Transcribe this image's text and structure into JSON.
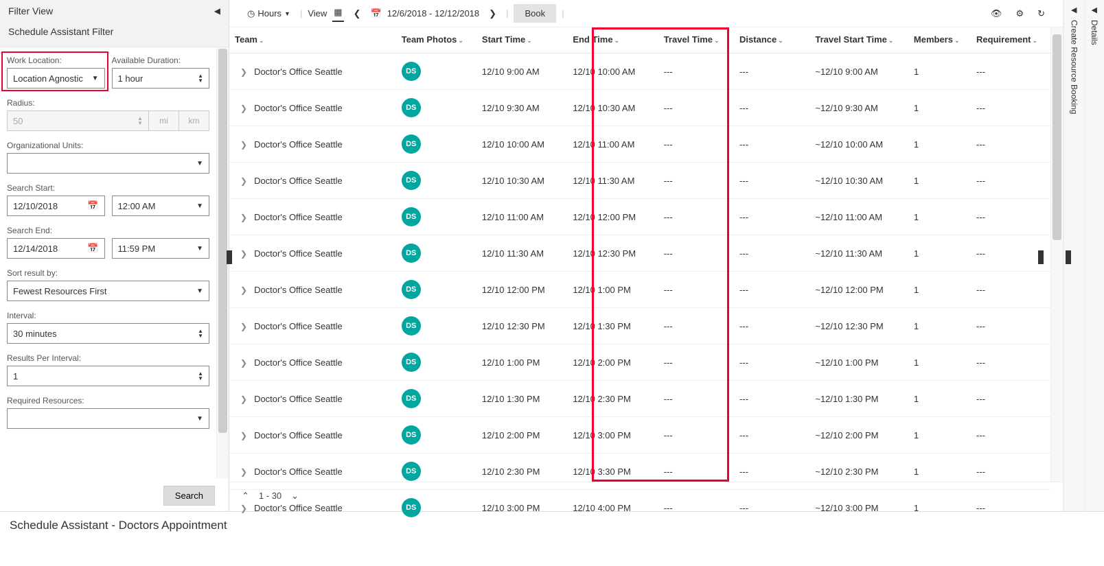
{
  "filter_panel": {
    "header": "Filter View",
    "section_title": "Schedule Assistant Filter",
    "work_location": {
      "label": "Work Location:",
      "value": "Location Agnostic"
    },
    "available_duration": {
      "label": "Available Duration:",
      "value": "1 hour"
    },
    "radius": {
      "label": "Radius:",
      "value": "50",
      "unit_mi": "mi",
      "unit_km": "km"
    },
    "org_units": {
      "label": "Organizational Units:",
      "value": ""
    },
    "search_start": {
      "label": "Search Start:",
      "date": "12/10/2018",
      "time": "12:00 AM"
    },
    "search_end": {
      "label": "Search End:",
      "date": "12/14/2018",
      "time": "11:59 PM"
    },
    "sort_by": {
      "label": "Sort result by:",
      "value": "Fewest Resources First"
    },
    "interval": {
      "label": "Interval:",
      "value": "30 minutes"
    },
    "results_per_interval": {
      "label": "Results Per Interval:",
      "value": "1"
    },
    "required_resources": {
      "label": "Required Resources:",
      "value": ""
    },
    "search_btn": "Search"
  },
  "toolbar": {
    "hours": "Hours",
    "view": "View",
    "date_range": "12/6/2018 - 12/12/2018",
    "book": "Book"
  },
  "columns": [
    "Team",
    "Team Photos",
    "Start Time",
    "End Time",
    "Travel Time",
    "Distance",
    "Travel Start Time",
    "Members",
    "Requirement"
  ],
  "rows": [
    {
      "team": "Doctor's Office Seattle",
      "photo": "DS",
      "start": "12/10 9:00 AM",
      "end": "12/10 10:00 AM",
      "travel_time": "---",
      "distance": "---",
      "travel_start": "~12/10 9:00 AM",
      "members": "1",
      "req": "---"
    },
    {
      "team": "Doctor's Office Seattle",
      "photo": "DS",
      "start": "12/10 9:30 AM",
      "end": "12/10 10:30 AM",
      "travel_time": "---",
      "distance": "---",
      "travel_start": "~12/10 9:30 AM",
      "members": "1",
      "req": "---"
    },
    {
      "team": "Doctor's Office Seattle",
      "photo": "DS",
      "start": "12/10 10:00 AM",
      "end": "12/10 11:00 AM",
      "travel_time": "---",
      "distance": "---",
      "travel_start": "~12/10 10:00 AM",
      "members": "1",
      "req": "---"
    },
    {
      "team": "Doctor's Office Seattle",
      "photo": "DS",
      "start": "12/10 10:30 AM",
      "end": "12/10 11:30 AM",
      "travel_time": "---",
      "distance": "---",
      "travel_start": "~12/10 10:30 AM",
      "members": "1",
      "req": "---"
    },
    {
      "team": "Doctor's Office Seattle",
      "photo": "DS",
      "start": "12/10 11:00 AM",
      "end": "12/10 12:00 PM",
      "travel_time": "---",
      "distance": "---",
      "travel_start": "~12/10 11:00 AM",
      "members": "1",
      "req": "---"
    },
    {
      "team": "Doctor's Office Seattle",
      "photo": "DS",
      "start": "12/10 11:30 AM",
      "end": "12/10 12:30 PM",
      "travel_time": "---",
      "distance": "---",
      "travel_start": "~12/10 11:30 AM",
      "members": "1",
      "req": "---"
    },
    {
      "team": "Doctor's Office Seattle",
      "photo": "DS",
      "start": "12/10 12:00 PM",
      "end": "12/10 1:00 PM",
      "travel_time": "---",
      "distance": "---",
      "travel_start": "~12/10 12:00 PM",
      "members": "1",
      "req": "---"
    },
    {
      "team": "Doctor's Office Seattle",
      "photo": "DS",
      "start": "12/10 12:30 PM",
      "end": "12/10 1:30 PM",
      "travel_time": "---",
      "distance": "---",
      "travel_start": "~12/10 12:30 PM",
      "members": "1",
      "req": "---"
    },
    {
      "team": "Doctor's Office Seattle",
      "photo": "DS",
      "start": "12/10 1:00 PM",
      "end": "12/10 2:00 PM",
      "travel_time": "---",
      "distance": "---",
      "travel_start": "~12/10 1:00 PM",
      "members": "1",
      "req": "---"
    },
    {
      "team": "Doctor's Office Seattle",
      "photo": "DS",
      "start": "12/10 1:30 PM",
      "end": "12/10 2:30 PM",
      "travel_time": "---",
      "distance": "---",
      "travel_start": "~12/10 1:30 PM",
      "members": "1",
      "req": "---"
    },
    {
      "team": "Doctor's Office Seattle",
      "photo": "DS",
      "start": "12/10 2:00 PM",
      "end": "12/10 3:00 PM",
      "travel_time": "---",
      "distance": "---",
      "travel_start": "~12/10 2:00 PM",
      "members": "1",
      "req": "---"
    },
    {
      "team": "Doctor's Office Seattle",
      "photo": "DS",
      "start": "12/10 2:30 PM",
      "end": "12/10 3:30 PM",
      "travel_time": "---",
      "distance": "---",
      "travel_start": "~12/10 2:30 PM",
      "members": "1",
      "req": "---"
    },
    {
      "team": "Doctor's Office Seattle",
      "photo": "DS",
      "start": "12/10 3:00 PM",
      "end": "12/10 4:00 PM",
      "travel_time": "---",
      "distance": "---",
      "travel_start": "~12/10 3:00 PM",
      "members": "1",
      "req": "---"
    }
  ],
  "pager": {
    "range": "1 - 30"
  },
  "right_rail": {
    "create": "Create Resource Booking",
    "details": "Details"
  },
  "footer": "Schedule Assistant - Doctors Appointment",
  "colors": {
    "accent_teal": "#00a7a0",
    "highlight_red": "#e03"
  }
}
